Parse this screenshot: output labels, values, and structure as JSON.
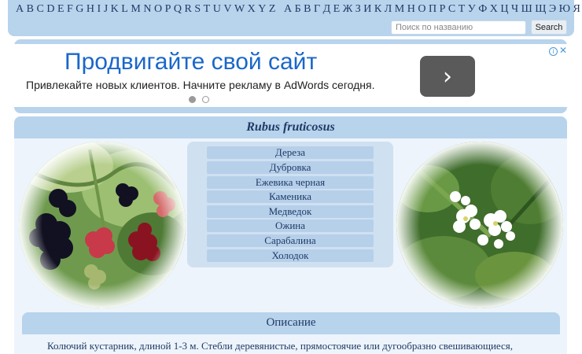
{
  "alphabet": {
    "latin": [
      "A",
      "B",
      "C",
      "D",
      "E",
      "F",
      "G",
      "H",
      "I",
      "J",
      "K",
      "L",
      "M",
      "N",
      "O",
      "P",
      "Q",
      "R",
      "S",
      "T",
      "U",
      "V",
      "W",
      "X",
      "Y",
      "Z"
    ],
    "cyrillic": [
      "А",
      "Б",
      "В",
      "Г",
      "Д",
      "Е",
      "Ж",
      "З",
      "И",
      "К",
      "Л",
      "М",
      "Н",
      "О",
      "П",
      "Р",
      "С",
      "Т",
      "У",
      "Ф",
      "Х",
      "Ц",
      "Ч",
      "Ш",
      "Щ",
      "Э",
      "Ю",
      "Я"
    ]
  },
  "search": {
    "placeholder": "Поиск по названию",
    "button_label": "Search"
  },
  "ad": {
    "title": "Продвигайте свой сайт",
    "subtitle": "Привлекайте новых клиентов. Начните рекламу в AdWords сегодня.",
    "arrow": "›",
    "info": "i",
    "close": "✕",
    "active_dot": 1,
    "dots": 2
  },
  "species": {
    "latin_name": "Rubus fruticosus",
    "names": [
      "Дереза",
      "Дубровка",
      "Ежевика черная",
      "Каменика",
      "Медведок",
      "Ожина",
      "Сарабалина",
      "Холодок"
    ]
  },
  "description": {
    "title": "Описание",
    "text": "Колючий кустарник, длиной 1-3 м. Стебли деревянистые, прямостоячие или дугообразно свешивающиеся,"
  },
  "colors": {
    "bar": "#b8d3ec",
    "panel": "#edf4fb",
    "ad_title": "#1a67c9",
    "text": "#1f3a66"
  }
}
